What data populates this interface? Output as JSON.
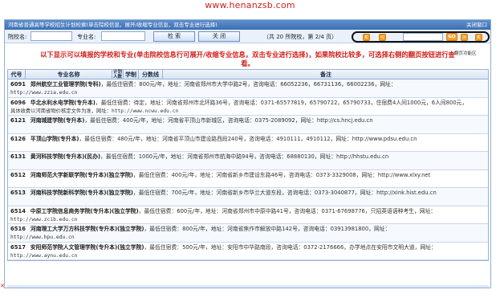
{
  "site": {
    "url": "www.henanzsb.com"
  },
  "window": {
    "title": "河南省普通高等学校招生计划检索(单击院校信息，展开/收缩专业信息，双击专业进行选择)",
    "close_label": "关闭窗口"
  },
  "toolbar": {
    "school_label": "院校名:",
    "school_value": "",
    "major_label": "专业名:",
    "major_value": "",
    "search_label": "检 索",
    "close_label": "关 闭",
    "stats": "（共 20 所院校，第 2/4 页）"
  },
  "pager": {
    "first": "K",
    "prev": "<",
    "page_value": "",
    "go": "GO",
    "next": ">",
    "last": "K",
    "hint": "翻页功能区"
  },
  "notice": "以下显示可以填报的学校和专业(单击院校信息行可展开/收缩专业信息，双击专业进行选择)，如果院校比较多，可选择右侧的翻页按钮进行查看。",
  "table": {
    "headers": {
      "code": "代号",
      "name": "专业名称",
      "plan": "计划人数",
      "length": "学制",
      "batch": "分数线",
      "note": "备注"
    },
    "rows": [
      {
        "code": "6091",
        "name": "郑州航空工业管理学院(专科)",
        "info": "，最低住宿费：800元/年，地址：河南省郑州市大学中路2号，咨询电话：66052236，66731136，66002236，网址：",
        "url": "http://www.zzia.edu.cn"
      },
      {
        "code": "6096",
        "name": "华北水利水电学院(专升本)",
        "info": "，最低住宿费：待定，地址：河南省郑州市北环路36号，咨询电话：0371-65577819，65790722，65790733，住宿费4人间1000元，6人间800元，",
        "url": "具体收费以河南省物价核定文件为准，网址：http://www.ncwu.edu.cn"
      },
      {
        "code": "6121",
        "name": "河南城建学院(专升本)",
        "info": "，最低住宿费：400元/年，地址：河南省平顶山市新城区，咨询电话：0375-2089092，网址：http://cs.hncj.edu.cn",
        "url": ""
      },
      {
        "code": "6126",
        "name": "平顶山学院(专升本)",
        "info": "，最低住宿费：480元/年，地址：河南省平顶山市建设路西段240号，咨询电话：4910111，4910112，网址：http://www.pdsu.edu.cn",
        "url": ""
      },
      {
        "code": "6131",
        "name": "黄河科技学院(专升本)(民办)",
        "info": "，最低住宿费：1000元/年，地址：河南省郑州市航海中路94号，咨询电话：68880130，网址：http://hhstu.edu.cn",
        "url": ""
      },
      {
        "code": "6512",
        "name": "河南师范大学新联学院(专升本)(独立学院)",
        "info": "，最低住宿费：400元/年，地址：河南省新乡市建设东路46号，咨询电话：0373-3329008，网址：http://www.xlxy.net",
        "url": ""
      },
      {
        "code": "6513",
        "name": "河南科技学院新科学院(专升本)(独立学院)",
        "info": "，最低住宿费：700元/年，地址：河南省新乡市华兰大道东段，咨询电话：0373-3040877，网址：http://xink.hist.edu.cn",
        "url": ""
      },
      {
        "code": "6514",
        "name": "中原工学院信息商务学院(专升本)(独立学院)",
        "info": "，最低住宿费：600元/年，地址：河南省郑州市中原中路41号，咨询电话：0371-67698776，只招英语语种考生，网址：",
        "url": "http://www.zcib.edu.cn"
      },
      {
        "code": "6516",
        "name": "河南理工大学万方科技学院(专升本)(独立学院)",
        "info": "，最低住宿费：800元/年，地址：河南省焦作市解放中路142号，咨询电话：03913981800，网址：",
        "url": "http://www.hpu.edu.cn"
      },
      {
        "code": "6517",
        "name": "安阳师范学院人文管理学院(专升本)(独立学院)",
        "info": "，最低住宿费：500元/年，地址：安阳市中华路南段，咨询电话：0372-2176666，办学地点在安阳市文明大道，网址：",
        "url": "http://www.aynu.edu.cn"
      }
    ]
  },
  "colors": {
    "accent_red": "#d0201a",
    "title_blue": "#3b6fb4",
    "pager_orange": "#f3a12a"
  }
}
